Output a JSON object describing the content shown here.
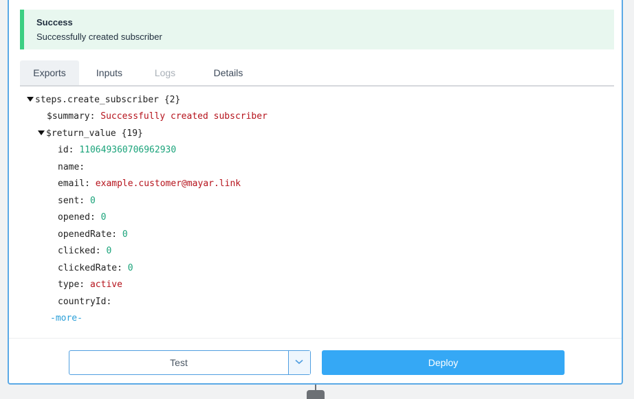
{
  "alert": {
    "title": "Success",
    "message": "Successfully created subscriber",
    "color": "#3ccf82"
  },
  "tabs": [
    {
      "label": "Exports",
      "active": true,
      "disabled": false
    },
    {
      "label": "Inputs",
      "active": false,
      "disabled": false
    },
    {
      "label": "Logs",
      "active": false,
      "disabled": true
    },
    {
      "label": "Details",
      "active": false,
      "disabled": false
    }
  ],
  "tree": {
    "root_key": "steps.create_subscriber",
    "root_count": "{2}",
    "summary_key": "$summary:",
    "summary_value": "Successfully created subscriber",
    "return_key": "$return_value",
    "return_count": "{19}",
    "fields": [
      {
        "key": "id:",
        "value": "110649360706962930",
        "kind": "num"
      },
      {
        "key": "name:",
        "value": "",
        "kind": "str"
      },
      {
        "key": "email:",
        "value": "example.customer@mayar.link",
        "kind": "str"
      },
      {
        "key": "sent:",
        "value": "0",
        "kind": "num"
      },
      {
        "key": "opened:",
        "value": "0",
        "kind": "num"
      },
      {
        "key": "openedRate:",
        "value": "0",
        "kind": "num"
      },
      {
        "key": "clicked:",
        "value": "0",
        "kind": "num"
      },
      {
        "key": "clickedRate:",
        "value": "0",
        "kind": "num"
      },
      {
        "key": "type:",
        "value": "active",
        "kind": "str"
      },
      {
        "key": "countryId:",
        "value": "",
        "kind": "str"
      }
    ],
    "more_label": "-more-"
  },
  "footer": {
    "test_label": "Test",
    "deploy_label": "Deploy",
    "accent": "#35a8f5"
  }
}
